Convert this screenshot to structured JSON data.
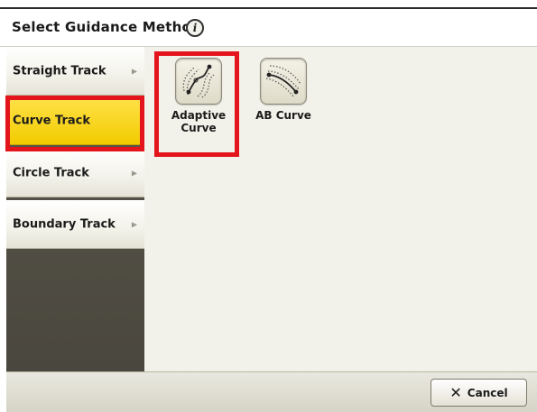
{
  "header": {
    "title": "Select Guidance Method",
    "info_icon": "info-icon"
  },
  "sidebar": {
    "items": [
      {
        "label": "Straight Track",
        "has_chevron": true,
        "selected": false
      },
      {
        "label": "Curve Track",
        "has_chevron": false,
        "selected": true
      },
      {
        "label": "Circle Track",
        "has_chevron": true,
        "selected": false
      },
      {
        "label": "Boundary Track",
        "has_chevron": true,
        "selected": false
      }
    ]
  },
  "options": [
    {
      "label": "Adaptive Curve",
      "icon": "adaptive-curve-icon",
      "highlighted": true
    },
    {
      "label": "AB Curve",
      "icon": "ab-curve-icon",
      "highlighted": false
    }
  ],
  "footer": {
    "cancel_label": "Cancel",
    "cancel_icon": "close-icon"
  },
  "colors": {
    "selected": "#f2cb00",
    "highlight": "#e3141b",
    "sidebar_dark": "#4a473e"
  }
}
